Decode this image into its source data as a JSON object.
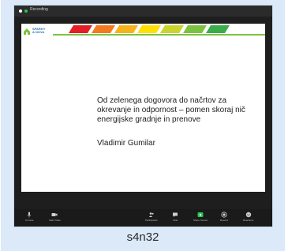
{
  "window": {
    "meeting_label": "Recording"
  },
  "slide": {
    "logo_text_line1": "SPARKY",
    "logo_text_line2": "& NOVA",
    "header_caption": "",
    "title": "Od zelenega dogovora do načrtov za okrevanje in odpornost – pomen skoraj nič energijske gradnje in prenove",
    "author": "Vladimir Gumilar",
    "stripe_colors": [
      "#e31e24",
      "#f47a20",
      "#f7b31b",
      "#ffe000",
      "#c9d52d",
      "#7cc242",
      "#3cab4a"
    ]
  },
  "toolbar": {
    "items": [
      {
        "name": "unmute",
        "label": "Unmute",
        "icon": "microphone-icon"
      },
      {
        "name": "start-video",
        "label": "Start Video",
        "icon": "video-camera-icon"
      },
      {
        "name": "participants",
        "label": "Participants",
        "icon": "participants-icon",
        "count": "21"
      },
      {
        "name": "chat",
        "label": "Chat",
        "icon": "chat-icon"
      },
      {
        "name": "share-screen",
        "label": "Share Screen",
        "icon": "share-screen-icon"
      },
      {
        "name": "record",
        "label": "Record",
        "icon": "record-icon"
      },
      {
        "name": "reactions",
        "label": "Reactions",
        "icon": "reactions-icon"
      }
    ]
  },
  "tile_caption": "s4n32"
}
